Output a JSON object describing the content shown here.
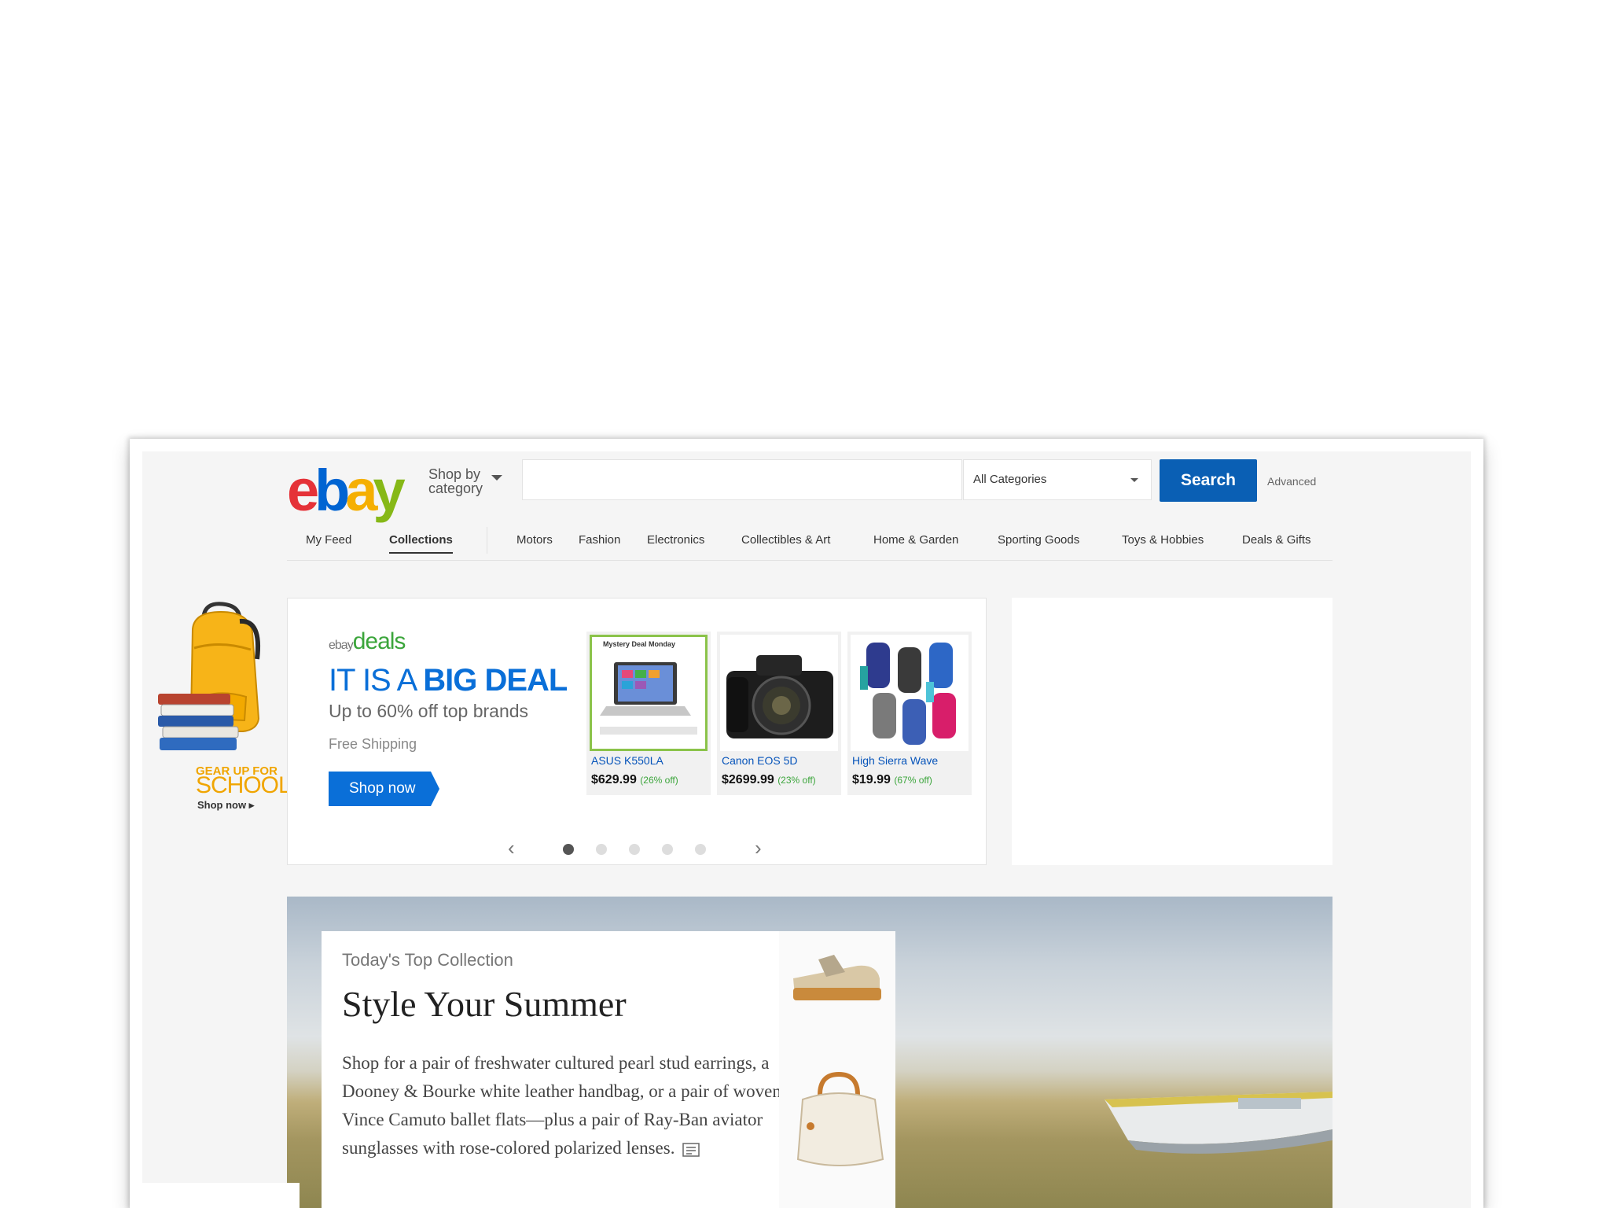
{
  "header": {
    "logo_parts": [
      "e",
      "b",
      "a",
      "y"
    ],
    "shop_by_line1": "Shop by",
    "shop_by_line2": "category",
    "search_placeholder": "",
    "category_selected": "All Categories",
    "search_button": "Search",
    "advanced_link": "Advanced"
  },
  "nav": {
    "items": [
      {
        "label": "My Feed"
      },
      {
        "label": "Collections"
      },
      {
        "label": "Motors"
      },
      {
        "label": "Fashion"
      },
      {
        "label": "Electronics"
      },
      {
        "label": "Collectibles & Art"
      },
      {
        "label": "Home & Garden"
      },
      {
        "label": "Sporting Goods"
      },
      {
        "label": "Toys & Hobbies"
      },
      {
        "label": "Deals & Gifts"
      }
    ],
    "active_index": 1
  },
  "school_ad": {
    "line1": "GEAR UP FOR",
    "line2": "SCHOOL",
    "cta": "Shop now ▸"
  },
  "deals": {
    "brand_small": "ebay",
    "brand_big": "deals",
    "headline_light": "IT IS A ",
    "headline_bold": "BIG DEAL",
    "subhead": "Up to 60% off top brands",
    "shipping": "Free Shipping",
    "cta": "Shop now",
    "products": [
      {
        "name": "ASUS K550LA",
        "price": "$629.99",
        "discount": "(26% off)",
        "badge": "Mystery Deal Monday"
      },
      {
        "name": "Canon EOS 5D",
        "price": "$2699.99",
        "discount": "(23% off)"
      },
      {
        "name": "High Sierra Wave",
        "price": "$19.99",
        "discount": "(67% off)"
      }
    ],
    "carousel": {
      "slides": 5,
      "active": 0
    }
  },
  "collection": {
    "eyebrow": "Today's Top Collection",
    "title": "Style Your Summer",
    "description": "Shop for a pair of freshwater cultured pearl stud earrings, a Dooney & Bourke white leather handbag, or a pair of woven Vince Camuto ballet flats—plus a pair of Ray-Ban aviator sunglasses with rose-colored polarized lenses."
  },
  "colors": {
    "ebay_red": "#e53238",
    "ebay_blue": "#0064d2",
    "ebay_yellow": "#f5af02",
    "ebay_green": "#86b817",
    "primary_button": "#0a5fb4",
    "deals_blue": "#0a6fd8",
    "discount_green": "#3ba53b",
    "school_orange": "#f0a500"
  }
}
